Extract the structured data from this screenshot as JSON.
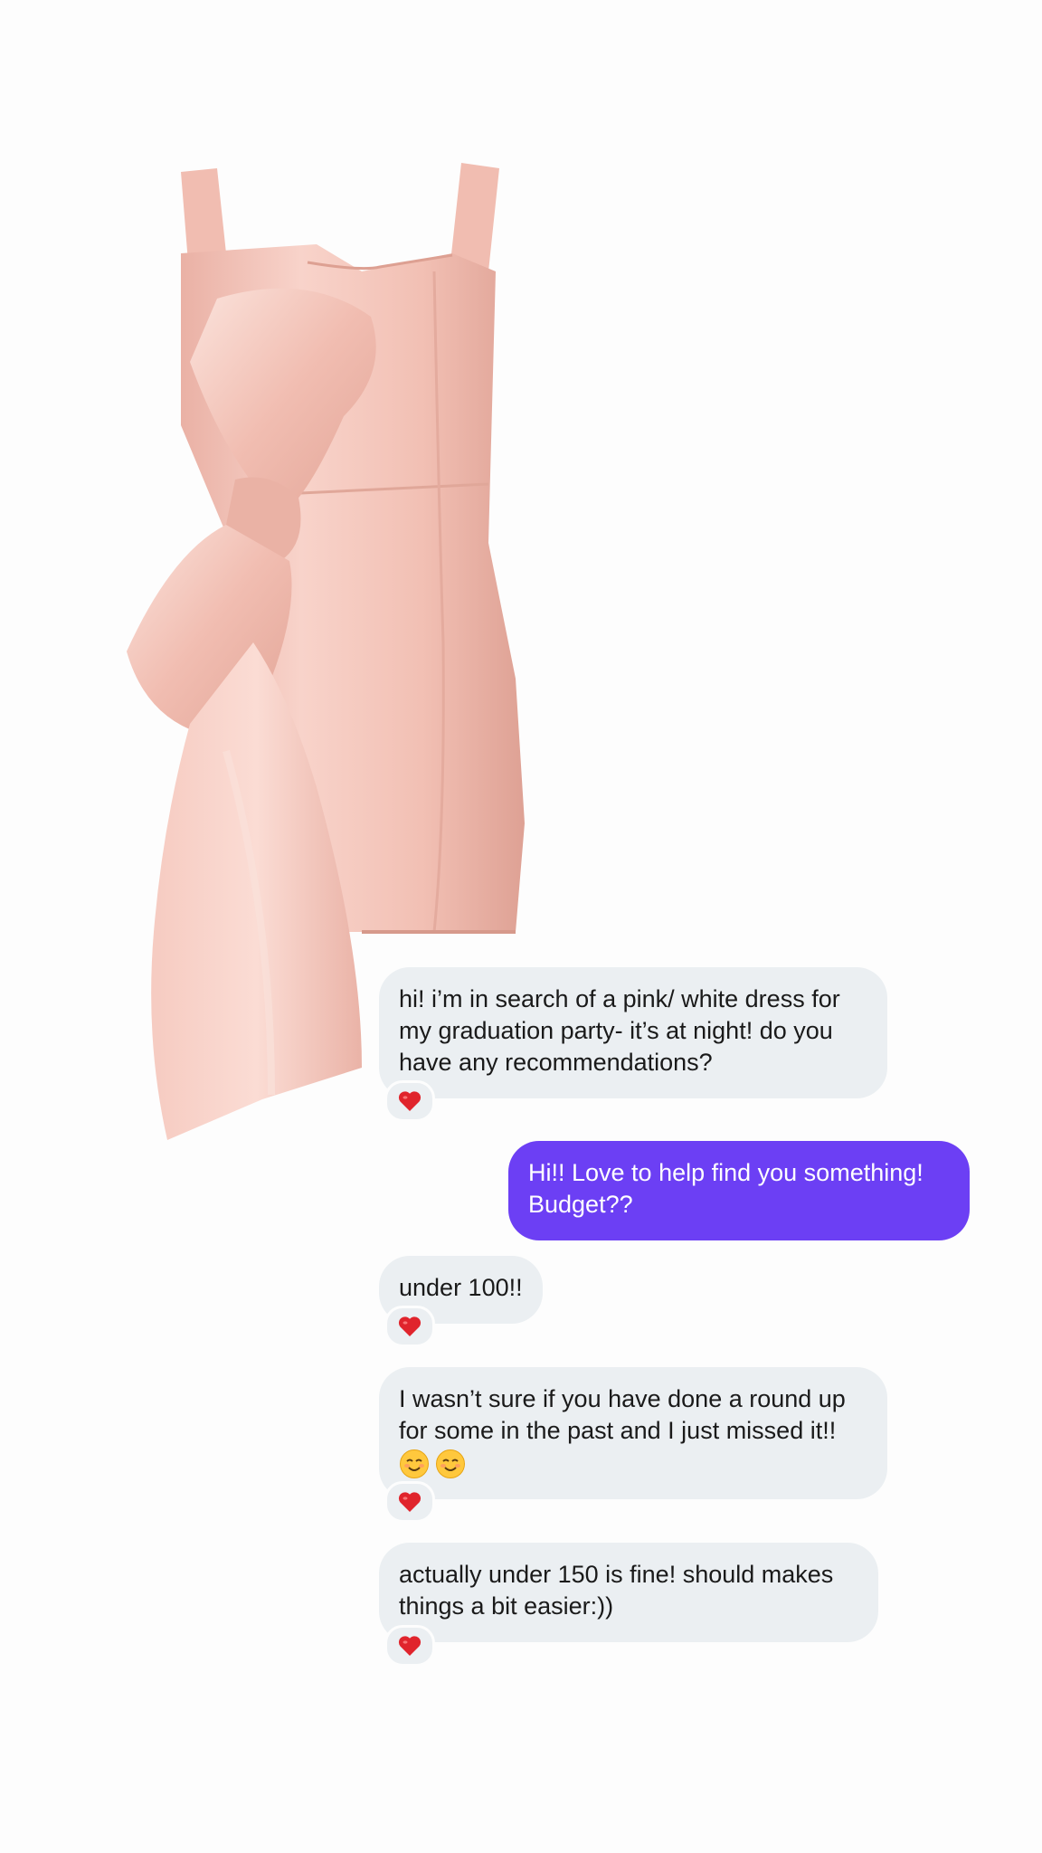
{
  "colors": {
    "background": "#fdfdfd",
    "received_bubble": "#ebeff2",
    "sent_bubble": "#6c3ff4",
    "dress_pink": "#f3c2b8",
    "heart": "#e0242c"
  },
  "image": {
    "subject_icon": "pink-bow-dress-image"
  },
  "messages": [
    {
      "direction": "received",
      "text": "hi! i’m in search of a pink/ white dress for my graduation party- it’s at night! do you have any recommendations?",
      "reaction": "red-heart-icon"
    },
    {
      "direction": "sent",
      "text": "Hi!! Love to help find you something! Budget??"
    },
    {
      "direction": "received",
      "text": "under 100!!",
      "reaction": "red-heart-icon"
    },
    {
      "direction": "received",
      "text": "I wasn’t sure if you have done a round up for some in the past and I just missed it!!",
      "emoji": [
        "smiling-face-icon",
        "smiling-face-icon"
      ],
      "reaction": "red-heart-icon"
    },
    {
      "direction": "received",
      "text": "actually under 150 is fine! should makes things a bit easier:))",
      "reaction": "red-heart-icon"
    }
  ]
}
